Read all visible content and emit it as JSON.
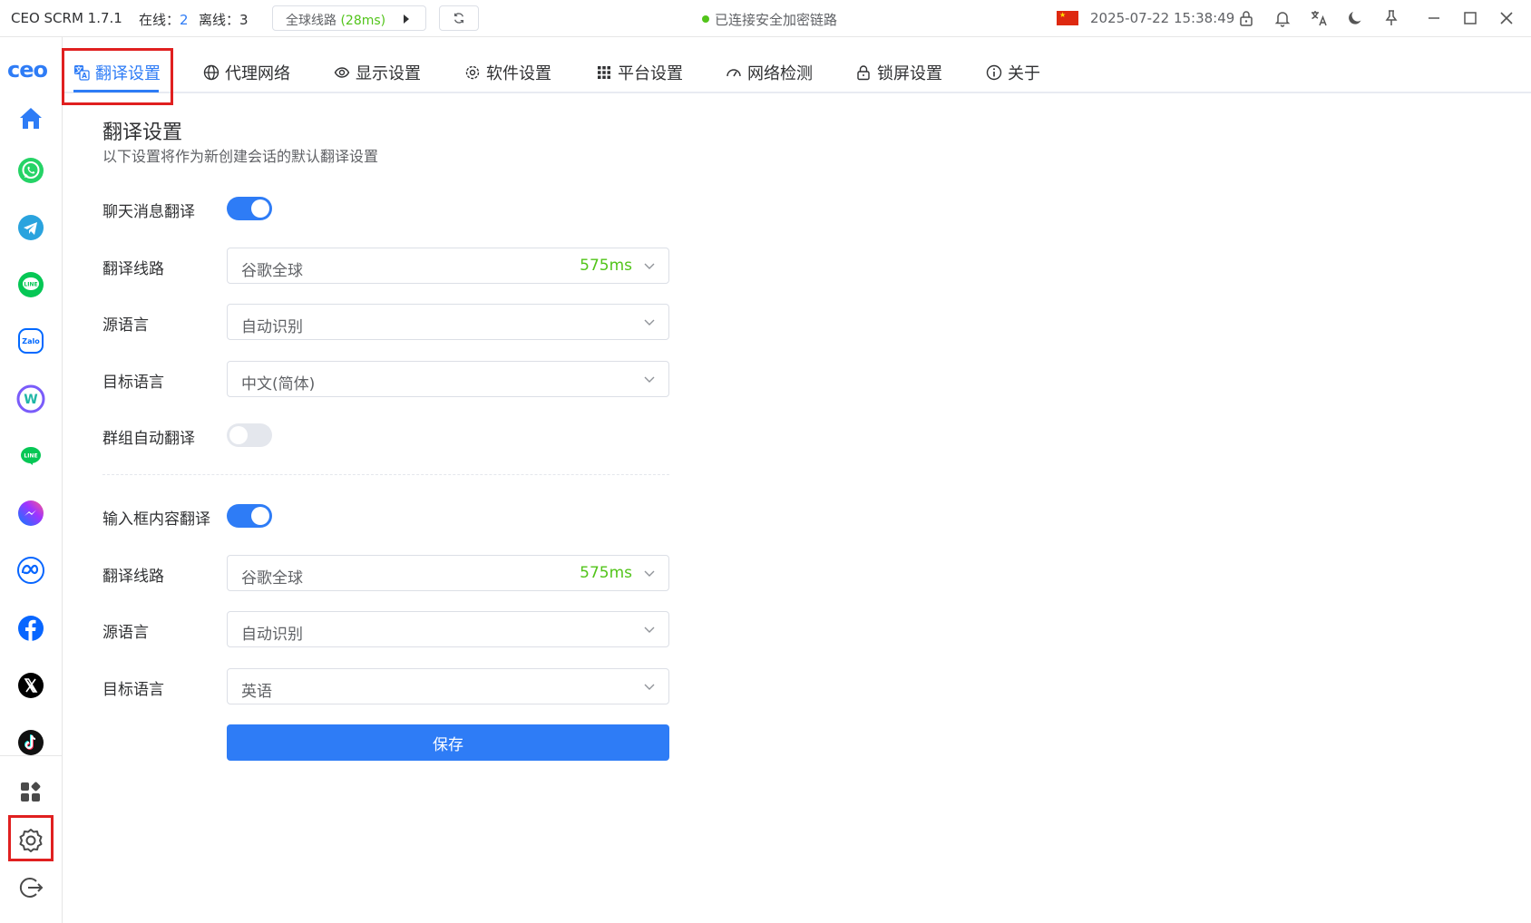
{
  "titlebar": {
    "app_name": "CEO SCRM 1.7.1",
    "online_label": "在线：",
    "online_count": "2",
    "offline_label": "离线：",
    "offline_count": "3",
    "route_label": "全球线路",
    "route_latency": "(28ms)",
    "connection_status": "已连接安全加密链路",
    "datetime": "2025-07-22 15:38:49"
  },
  "sidebar": {
    "logo": "ceo",
    "apps": [
      "home",
      "whatsapp",
      "telegram",
      "line",
      "zalo",
      "wa-multi",
      "line-green",
      "messenger",
      "meta",
      "facebook",
      "x",
      "tiktok"
    ]
  },
  "tabs": [
    {
      "label": "翻译设置",
      "icon": "translate-icon"
    },
    {
      "label": "代理网络",
      "icon": "globe-icon"
    },
    {
      "label": "显示设置",
      "icon": "eye-icon"
    },
    {
      "label": "软件设置",
      "icon": "gear-icon"
    },
    {
      "label": "平台设置",
      "icon": "grid-icon"
    },
    {
      "label": "网络检测",
      "icon": "gauge-icon"
    },
    {
      "label": "锁屏设置",
      "icon": "lock-icon"
    },
    {
      "label": "关于",
      "icon": "info-icon"
    }
  ],
  "content": {
    "title": "翻译设置",
    "subtitle": "以下设置将作为新创建会话的默认翻译设置",
    "chat": {
      "toggle_label": "聊天消息翻译",
      "toggle_on": true,
      "route_label": "翻译线路",
      "route_value": "谷歌全球",
      "route_latency": "575ms",
      "source_label": "源语言",
      "source_value": "自动识别",
      "target_label": "目标语言",
      "target_value": "中文(简体)",
      "group_label": "群组自动翻译",
      "group_on": false
    },
    "input": {
      "toggle_label": "输入框内容翻译",
      "toggle_on": true,
      "route_label": "翻译线路",
      "route_value": "谷歌全球",
      "route_latency": "575ms",
      "source_label": "源语言",
      "source_value": "自动识别",
      "target_label": "目标语言",
      "target_value": "英语"
    },
    "save_label": "保存"
  },
  "colors": {
    "accent": "#2e7cf6",
    "latency_green": "#52c41a",
    "highlight_red": "#e02020"
  }
}
